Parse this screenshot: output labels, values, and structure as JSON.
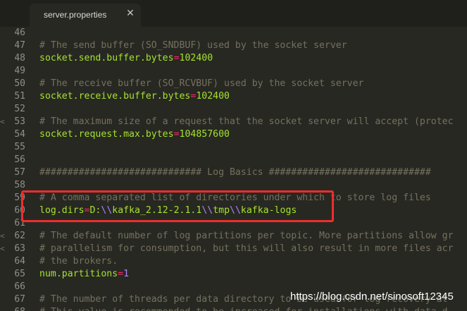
{
  "tab": {
    "title": "server.properties"
  },
  "lines": [
    {
      "num": "46",
      "fold": "",
      "parts": []
    },
    {
      "num": "47",
      "fold": "",
      "parts": [
        {
          "t": "# The send buffer (SO_SNDBUF) used by the socket server",
          "c": "cmt"
        }
      ]
    },
    {
      "num": "48",
      "fold": "",
      "parts": [
        {
          "t": "socket.send.buffer.bytes",
          "c": "key"
        },
        {
          "t": "=",
          "c": "eq"
        },
        {
          "t": "102400",
          "c": "key"
        }
      ]
    },
    {
      "num": "49",
      "fold": "",
      "parts": []
    },
    {
      "num": "50",
      "fold": "",
      "parts": [
        {
          "t": "# The receive buffer (SO_RCVBUF) used by the socket server",
          "c": "cmt"
        }
      ]
    },
    {
      "num": "51",
      "fold": "",
      "parts": [
        {
          "t": "socket.receive.buffer.bytes",
          "c": "key"
        },
        {
          "t": "=",
          "c": "eq"
        },
        {
          "t": "102400",
          "c": "key"
        }
      ]
    },
    {
      "num": "52",
      "fold": "",
      "parts": []
    },
    {
      "num": "53",
      "fold": "<",
      "parts": [
        {
          "t": "# The maximum size of a request that the socket server will accept (protec",
          "c": "cmt"
        }
      ]
    },
    {
      "num": "54",
      "fold": "",
      "parts": [
        {
          "t": "socket.request.max.bytes",
          "c": "key"
        },
        {
          "t": "=",
          "c": "eq"
        },
        {
          "t": "104857600",
          "c": "key"
        }
      ]
    },
    {
      "num": "55",
      "fold": "",
      "parts": []
    },
    {
      "num": "56",
      "fold": "",
      "parts": []
    },
    {
      "num": "57",
      "fold": "",
      "parts": [
        {
          "t": "############################# Log Basics #############################",
          "c": "cmt"
        }
      ]
    },
    {
      "num": "58",
      "fold": "",
      "parts": []
    },
    {
      "num": "59",
      "fold": "",
      "parts": [
        {
          "t": "# A comma separated list of directories under which to store log files",
          "c": "cmt"
        }
      ]
    },
    {
      "num": "60",
      "fold": "",
      "parts": [
        {
          "t": "log.dirs",
          "c": "key"
        },
        {
          "t": "=",
          "c": "eq"
        },
        {
          "t": "D:",
          "c": "key"
        },
        {
          "t": "\\\\",
          "c": "esc"
        },
        {
          "t": "kafka_2.12-2.1.1",
          "c": "key"
        },
        {
          "t": "\\\\",
          "c": "esc"
        },
        {
          "t": "tmp",
          "c": "key"
        },
        {
          "t": "\\\\",
          "c": "esc"
        },
        {
          "t": "kafka-logs",
          "c": "key"
        }
      ]
    },
    {
      "num": "61",
      "fold": "",
      "parts": []
    },
    {
      "num": "62",
      "fold": "<",
      "parts": [
        {
          "t": "# The default number of log partitions per topic. More partitions allow gr",
          "c": "cmt"
        }
      ]
    },
    {
      "num": "63",
      "fold": "<",
      "parts": [
        {
          "t": "# parallelism for consumption, but this will also result in more files acr",
          "c": "cmt"
        }
      ]
    },
    {
      "num": "64",
      "fold": "",
      "parts": [
        {
          "t": "# the brokers.",
          "c": "cmt"
        }
      ]
    },
    {
      "num": "65",
      "fold": "",
      "parts": [
        {
          "t": "num.partitions",
          "c": "key"
        },
        {
          "t": "=",
          "c": "eq"
        },
        {
          "t": "1",
          "c": "num"
        }
      ]
    },
    {
      "num": "66",
      "fold": "",
      "parts": []
    },
    {
      "num": "67",
      "fold": "",
      "parts": [
        {
          "t": "# The number of threads per data directory to be used for log recovery at",
          "c": "cmt"
        }
      ]
    },
    {
      "num": "68",
      "fold": "",
      "parts": [
        {
          "t": "# This value is recommended to be increased for installations with data d",
          "c": "cmt"
        }
      ]
    }
  ],
  "watermark": "https://blog.csdn.net/sinosoft12345"
}
